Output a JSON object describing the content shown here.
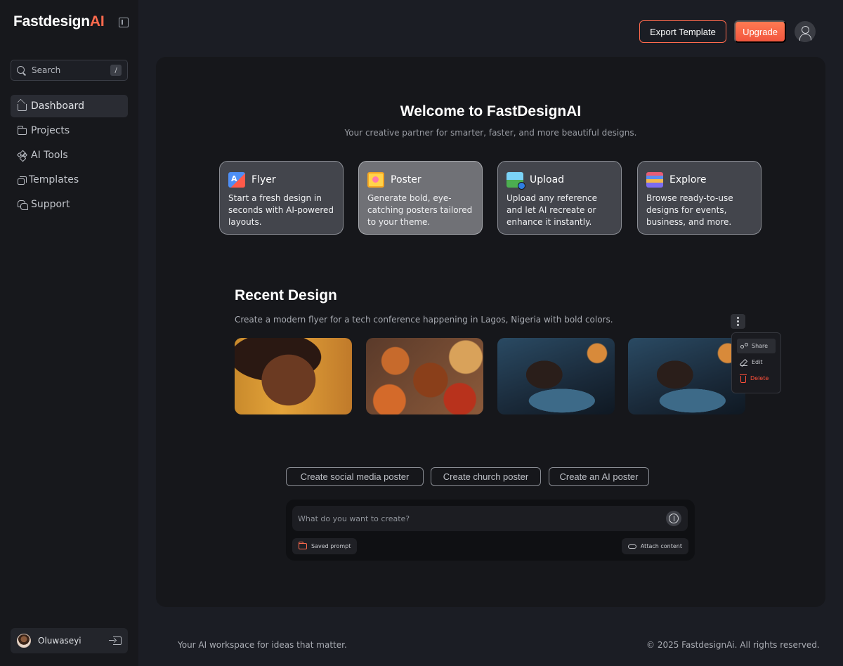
{
  "brand": {
    "name": "Fastdesign",
    "accent": "AI",
    "accent_color": "#ff6a4d"
  },
  "sidebar": {
    "search": {
      "label": "Search",
      "shortcut": "/"
    },
    "items": [
      {
        "label": "Dashboard",
        "icon": "home-icon",
        "active": true
      },
      {
        "label": "Projects",
        "icon": "folder-icon"
      },
      {
        "label": "AI Tools",
        "icon": "ai-tools-icon"
      },
      {
        "label": "Templates",
        "icon": "templates-icon"
      },
      {
        "label": "Support",
        "icon": "support-icon"
      }
    ],
    "user": {
      "name": "Oluwaseyi"
    }
  },
  "header": {
    "export_label": "Export Template",
    "upgrade_label": "Upgrade"
  },
  "main": {
    "title": "Welcome to FastDesignAI",
    "tagline": "Your creative partner for smarter, faster, and more beautiful designs.",
    "cards": [
      {
        "title": "Flyer",
        "desc": "Start a fresh design in seconds with AI-powered layouts.",
        "icon": "flyer-icon"
      },
      {
        "title": "Poster",
        "desc": "Generate bold, eye-catching posters tailored to your theme.",
        "icon": "poster-icon",
        "active": true
      },
      {
        "title": "Upload",
        "desc": "Upload any reference and let AI recreate or enhance it instantly.",
        "icon": "upload-image-icon"
      },
      {
        "title": "Explore",
        "desc": "Browse ready-to-use designs for events, business, and more.",
        "icon": "explore-icon"
      }
    ],
    "recent": {
      "title": "Recent Design",
      "prompt": "Create a modern flyer for a tech conference happening in Lagos, Nigeria with bold colors.",
      "menu": {
        "share": "Share",
        "edit": "Edit",
        "delete": "Delete"
      }
    },
    "suggestions": [
      "Create social media poster",
      "Create church poster",
      "Create an AI poster"
    ],
    "composer": {
      "placeholder": "What do you want to create?",
      "saved_prompt": "Saved prompt",
      "attach": "Attach content"
    }
  },
  "footer": {
    "left": "Your AI workspace for ideas that matter.",
    "right": "© 2025 FastdesignAi. All rights reserved."
  },
  "colors": {
    "accent": "#ff6a4d",
    "background": "#1b1d24",
    "panel": "#16171b",
    "danger": "#ff4f3a"
  }
}
